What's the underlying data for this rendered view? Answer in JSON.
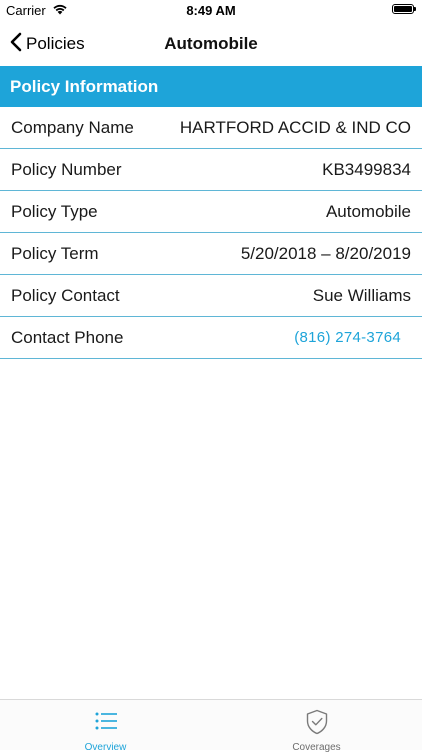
{
  "status_bar": {
    "carrier": "Carrier",
    "time": "8:49 AM",
    "icons": [
      "wifi-icon",
      "battery-icon"
    ]
  },
  "nav": {
    "back_label": "Policies",
    "title": "Automobile",
    "back_icon": "chevron-left-icon"
  },
  "section": {
    "title": "Policy Information"
  },
  "rows": [
    {
      "label": "Company Name",
      "value": "HARTFORD ACCID & IND CO"
    },
    {
      "label": "Policy Number",
      "value": "KB3499834"
    },
    {
      "label": "Policy Type",
      "value": "Automobile"
    },
    {
      "label": "Policy Term",
      "value": "5/20/2018 – 8/20/2019"
    },
    {
      "label": "Policy Contact",
      "value": "Sue Williams"
    },
    {
      "label": "Contact Phone",
      "value": "(816) 274-3764"
    }
  ],
  "tab_bar": {
    "tabs": [
      {
        "label": "Overview",
        "icon": "list-icon",
        "selected": true
      },
      {
        "label": "Coverages",
        "icon": "shield-check-icon",
        "selected": false
      }
    ]
  },
  "colors": {
    "accent": "#1ea4d9",
    "divider": "#5fb6d6",
    "inactive_tab": "#6d6d6d"
  }
}
